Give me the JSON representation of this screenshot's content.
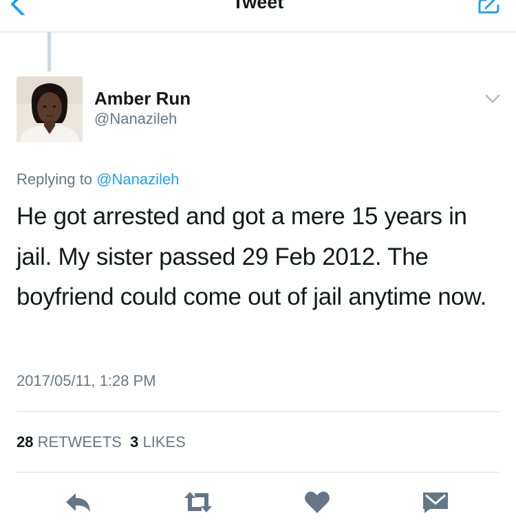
{
  "nav": {
    "title": "Tweet"
  },
  "tweet": {
    "display_name": "Amber Run",
    "username": "@Nanazileh",
    "replying_prefix": "Replying to ",
    "replying_to": "@Nanazileh",
    "text": "He got arrested and got a mere 15 years in jail. My sister passed 29 Feb 2012. The boyfriend could come out of jail anytime now.",
    "timestamp": "2017/05/11, 1:28 PM",
    "retweets_count": "28",
    "retweets_label": "RETWEETS",
    "likes_count": "3",
    "likes_label": "LIKES"
  },
  "icons": {
    "back": "chevron-left-icon",
    "compose": "compose-icon",
    "more": "chevron-down-icon",
    "reply": "reply-icon",
    "retweet": "retweet-icon",
    "like": "heart-icon",
    "dm": "envelope-icon"
  },
  "colors": {
    "accent": "#1da1f2",
    "secondary_text": "#657786",
    "action_icon": "#657786"
  }
}
